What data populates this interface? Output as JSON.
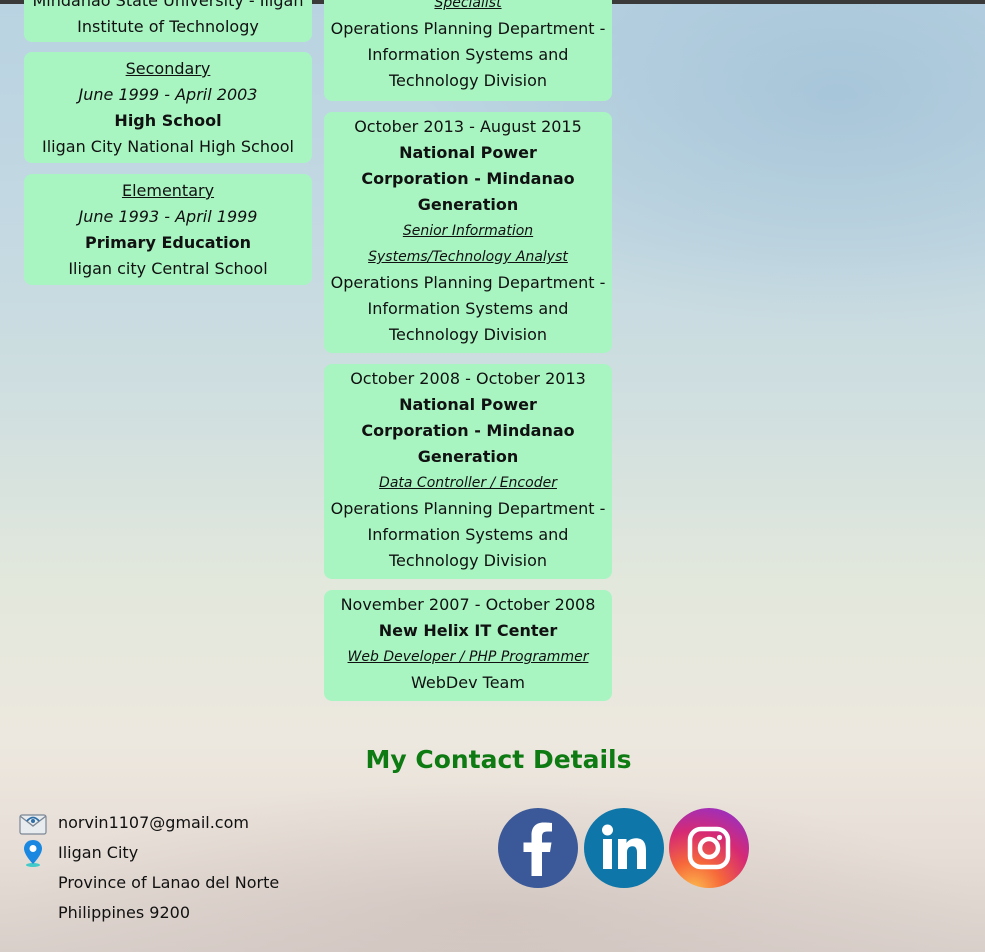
{
  "education": [
    {
      "line1": "Mindanao State University - Iligan",
      "line2": "Institute of Technology"
    },
    {
      "level": "Secondary",
      "dates": "June 1999 - April 2003",
      "title": "High School",
      "school": "Iligan City National High School"
    },
    {
      "level": "Elementary",
      "dates": "June 1993 - April 1999",
      "title": "Primary Education",
      "school": "Iligan city Central School"
    }
  ],
  "experience": [
    {
      "position": "Specialist",
      "dept": [
        "Operations Planning Department -",
        "Information Systems and",
        "Technology Division"
      ]
    },
    {
      "dates": "October 2013 - August 2015",
      "company": [
        "National Power",
        "Corporation - Mindanao",
        "Generation"
      ],
      "position": [
        "Senior Information",
        "Systems/Technology Analyst"
      ],
      "dept": [
        "Operations Planning Department -",
        "Information Systems and",
        "Technology Division"
      ]
    },
    {
      "dates": "October 2008 - October 2013",
      "company": [
        "National Power",
        "Corporation - Mindanao",
        "Generation"
      ],
      "position": "Data Controller / Encoder",
      "dept": [
        "Operations Planning Department -",
        "Information Systems and",
        "Technology Division"
      ]
    },
    {
      "dates": "November 2007 - October 2008",
      "company": "New Helix IT Center",
      "position": "Web Developer / PHP Programmer",
      "dept": "WebDev Team"
    }
  ],
  "contact": {
    "title": "My Contact Details",
    "email": "norvin1107@gmail.com",
    "address": [
      "Iligan City",
      "Province of Lanao del Norte",
      "Philippines 9200"
    ],
    "email_icon": "envelope-icon",
    "location_icon": "map-pin-icon"
  },
  "social": [
    {
      "name": "facebook-icon",
      "color": "#3b5998"
    },
    {
      "name": "linkedin-icon",
      "color": "#0e76a8"
    },
    {
      "name": "instagram-icon",
      "color": "#c13584"
    }
  ],
  "colors": {
    "card": "#a8f5c2",
    "heading": "#0d7a12"
  }
}
